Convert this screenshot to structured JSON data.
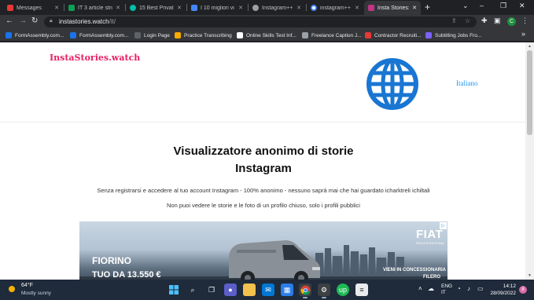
{
  "browser": {
    "tabs": [
      {
        "title": "Messages",
        "fav_color": "#e53935",
        "active": false
      },
      {
        "title": "IT 3 article stru",
        "fav_color": "#0f9d58",
        "active": false
      },
      {
        "title": "15 Best Private",
        "fav_color": "#00bfa5",
        "active": false
      },
      {
        "title": "I 10 migliori vi",
        "fav_color": "#4285f4",
        "active": false
      },
      {
        "title": "Instagram++ |",
        "fav_color": "#9aa0a6",
        "active": false
      },
      {
        "title": "instagram++",
        "fav_color": "#4285f4",
        "active": false
      },
      {
        "title": "Insta Stories: V",
        "fav_color": "#c13584",
        "active": true
      }
    ],
    "new_tab": "+",
    "url_host": "instastories.watch",
    "url_path": "/it/",
    "profile_initial": "C",
    "bookmarks": [
      {
        "label": "FormAssembly.com...",
        "fav_color": "#1a73e8"
      },
      {
        "label": "FormAssembly.com...",
        "fav_color": "#1a73e8"
      },
      {
        "label": "Login Page",
        "fav_color": "#5f6368"
      },
      {
        "label": "Practice Transcribing",
        "fav_color": "#f9ab00"
      },
      {
        "label": "Online Skills Test Inf...",
        "fav_color": "#ffffff"
      },
      {
        "label": "Freelance Caption J...",
        "fav_color": "#9aa0a6"
      },
      {
        "label": "Contractor Recruiti...",
        "fav_color": "#e53935"
      },
      {
        "label": "Subtitling Jobs Fro...",
        "fav_color": "#7b61ff"
      }
    ]
  },
  "site": {
    "logo": "InstaStories.watch",
    "language": "Italiano",
    "title_line1": "Visualizzatore anonimo di storie",
    "title_line2": "Instagram",
    "subtitle1": "Senza registrarsi e accedere al tuo account Instagram - 100% anonimo - nessuno saprà mai che hai guardato icharktreli ichiltali",
    "subtitle2": "Non puoi vedere le storie e le foto di un profilo chiuso, solo i profili pubblici",
    "accent_color": "#e91e63",
    "link_color": "#2196f3"
  },
  "ad": {
    "brand": "FIAT",
    "brand_sub": "PROFESSIONAL",
    "model": "FIORINO",
    "price": "TUO DA 13.550 €",
    "cta_line1": "VIENI IN CONCESSIONARIA",
    "cta_line2": "FILERO"
  },
  "taskbar": {
    "temperature": "64°F",
    "weather": "Mostly sunny",
    "lang_line1": "ENG",
    "lang_line2": "IT",
    "time": "14:12",
    "date": "28/09/2022",
    "notifications": "8"
  }
}
